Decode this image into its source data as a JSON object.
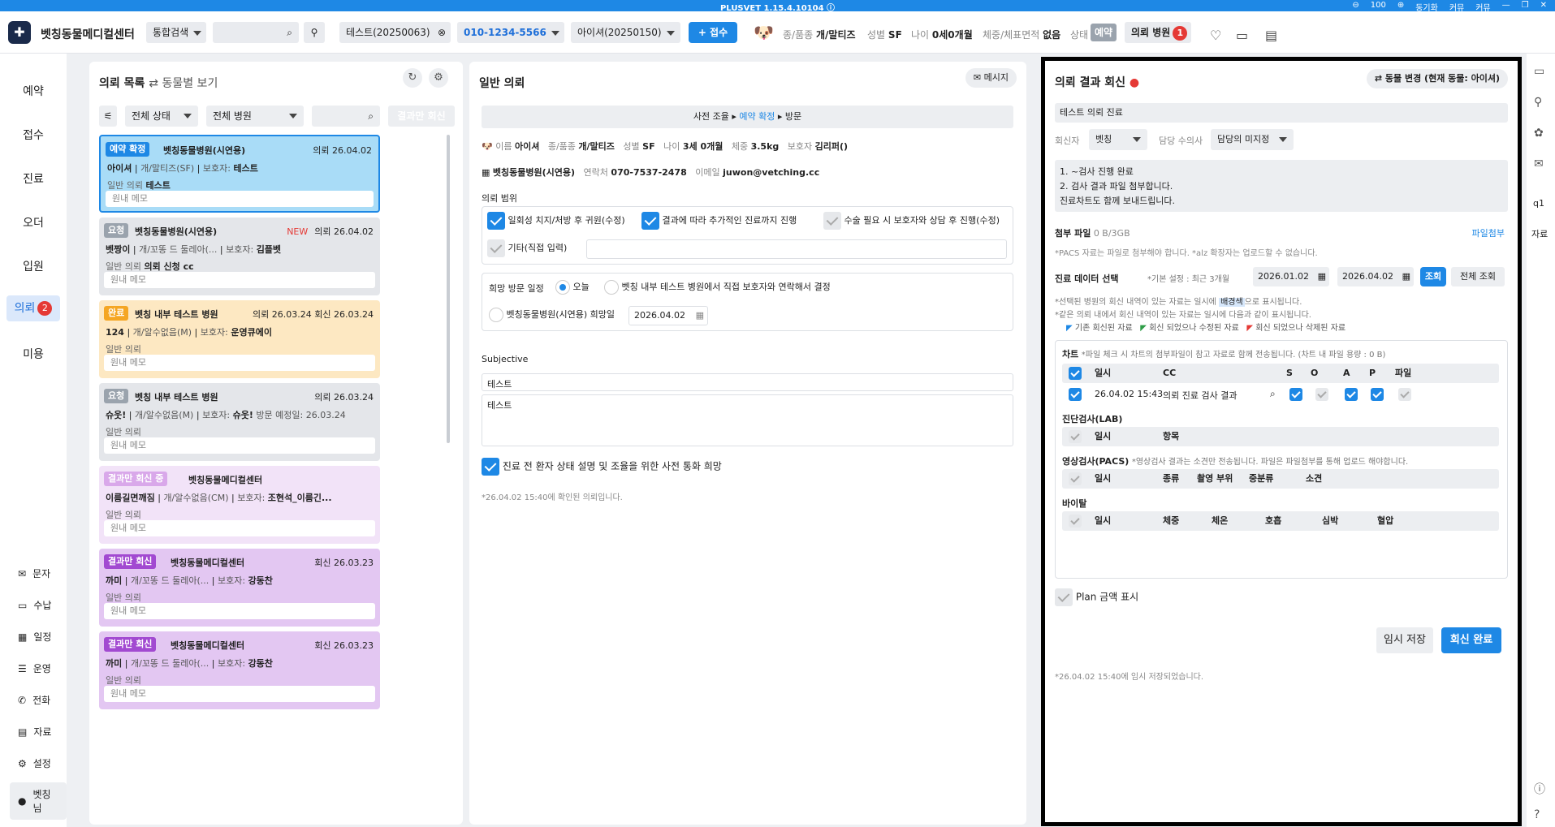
{
  "titlebar": {
    "app_version": "PLUSVET 1.15.4.10104",
    "zoom": "100",
    "links": [
      "동기화",
      "커뮤",
      "커뮤"
    ]
  },
  "topbar": {
    "brand": "벳칭동물메디컬센터",
    "search_type": "통합검색",
    "search_placeholder": "",
    "owner_chip": "테스트(20250063)",
    "phone": "010-1234-5566",
    "patient_chip": "아이셔(20250150)",
    "reception_button": "+ 접수",
    "species_label": "종/품종",
    "species_value": "개/말티즈",
    "sex_label": "성별",
    "sex_value": "SF",
    "age_label": "나이",
    "age_value": "0세0개월",
    "weight_label": "체중/체표면적",
    "weight_value": "없음",
    "status_label": "상태",
    "status_value": "예약",
    "referral_hospital": "의뢰 병원",
    "referral_count": "1"
  },
  "leftnav": {
    "items": [
      "예약",
      "접수",
      "진료",
      "오더",
      "입원",
      "의뢰",
      "미용"
    ],
    "active_index": 5,
    "referral_badge": "2",
    "bottom": [
      "문자",
      "수납",
      "일정",
      "운영",
      "전화",
      "자료",
      "설정",
      "벳칭님"
    ]
  },
  "list_panel": {
    "title": "의뢰 목록",
    "toggle": "동물별 보기",
    "status_filter": "전체 상태",
    "hospital_filter": "전체 병원",
    "result_only_button": "결과만 회신",
    "cards": [
      {
        "tag": "예약 확정",
        "hospital": "벳칭동물병원(시연용)",
        "date": "의뢰 26.04.02",
        "new": "",
        "patient": "아이셔",
        "breed": "개/말티즈(SF)",
        "owner_label": "보호자:",
        "owner": "테스트",
        "extra": "",
        "type": "일반 의뢰",
        "type_value": "테스트",
        "memo": "원내 메모"
      },
      {
        "tag": "요청",
        "hospital": "벳칭동물병원(시연용)",
        "date": "의뢰 26.04.02",
        "new": "NEW",
        "patient": "벳짱이",
        "breed": "개/꼬똥 드 둘레아(...",
        "owner_label": "보호자:",
        "owner": "김플벳",
        "extra": "",
        "type": "일반 의뢰",
        "type_value": "의뢰 신청 cc",
        "memo": "원내 메모"
      },
      {
        "tag": "완료",
        "hospital": "벳칭 내부 테스트 병원",
        "date": "의뢰 26.03.24  회신 26.03.24",
        "new": "",
        "patient": "124",
        "breed": "개/알수없음(M)",
        "owner_label": "보호자:",
        "owner": "운영큐에이",
        "extra": "",
        "type": "일반 의뢰",
        "type_value": "",
        "memo": "원내 메모"
      },
      {
        "tag": "요청",
        "hospital": "벳칭 내부 테스트 병원",
        "date": "의뢰 26.03.24",
        "new": "",
        "patient": "슈웃!",
        "breed": "개/알수없음(M)",
        "owner_label": "보호자:",
        "owner": "슈웃!",
        "extra": "방문 예정일: 26.03.24",
        "type": "일반 의뢰",
        "type_value": "",
        "memo": "원내 메모"
      },
      {
        "tag": "결과만 회신 중",
        "hospital": "벳칭동물메디컬센터",
        "date": "",
        "new": "",
        "patient": "이름길면깨짐",
        "breed": "개/알수없음(CM)",
        "owner_label": "보호자:",
        "owner": "조현석_이름긴...",
        "extra": "",
        "type": "일반 의뢰",
        "type_value": "",
        "memo": "원내 메모"
      },
      {
        "tag": "결과만 회신",
        "hospital": "벳칭동물메디컬센터",
        "date": "회신 26.03.23",
        "new": "",
        "patient": "까미",
        "breed": "개/꼬똥 드 둘레아(...",
        "owner_label": "보호자:",
        "owner": "강동찬",
        "extra": "",
        "type": "일반 의뢰",
        "type_value": "",
        "memo": "원내 메모"
      },
      {
        "tag": "결과만 회신",
        "hospital": "벳칭동물메디컬센터",
        "date": "회신 26.03.23",
        "new": "",
        "patient": "까미",
        "breed": "개/꼬똥 드 둘레아(...",
        "owner_label": "보호자:",
        "owner": "강동찬",
        "extra": "",
        "type": "일반 의뢰",
        "type_value": "",
        "memo": "원내 메모"
      }
    ]
  },
  "mid_panel": {
    "title": "일반 의뢰",
    "message_button": "메시지",
    "steps": [
      "사전 조율",
      "예약 확정",
      "방문"
    ],
    "name_label": "이름",
    "name": "아이셔",
    "species_label": "종/품종",
    "species": "개/말티즈",
    "sex_label": "성별",
    "sex": "SF",
    "age_label": "나이",
    "age": "3세 0개월",
    "weight_label": "체중",
    "weight": "3.5kg",
    "owner_label": "보호자",
    "owner": "김리퍼()",
    "hospital": "벳칭동물병원(시연용)",
    "contact_label": "연락처",
    "contact": "070-7537-2478",
    "email_label": "이메일",
    "email": "juwon@vetching.cc",
    "scope_title": "의뢰 범위",
    "scope1": "일회성 치지/처방 후 귀원(수정)",
    "scope2": "결과에 따라 추가적인 진료까지 진행",
    "scope3": "수술 필요 시 보호자와 상담 후 진행(수정)",
    "scope4": "기타(직접 입력)",
    "visit_title": "희망 방문 일정",
    "visit_opt1": "오늘",
    "visit_opt2": "벳칭 내부 테스트 병원에서 직접 보호자와 연락해서 결정",
    "visit_opt3": "벳칭동물병원(시연용) 희망일",
    "visit_date": "2026.04.02",
    "subjective_title": "Subjective",
    "subjective_1": "테스트",
    "subjective_2": "테스트",
    "phone_call_check": "진료 전 환자 상태 설명 및 조율을 위한 사전 통화 희망",
    "confirmed_note": "*26.04.02 15:40에 확인된 의뢰입니다."
  },
  "right_panel": {
    "title": "의뢰 결과 회신",
    "change_animal_button": "동물 변경 (현재 동물: 아이셔)",
    "subject": "테스트 의뢰 진료",
    "replier_label": "회신자",
    "replier": "벳칭",
    "vet_label": "담당 수의사",
    "vet": "담당의 미지정",
    "body_lines": [
      "1. ~검사 진행 완료",
      "2. 검사 결과 파일 첨부합니다.",
      "진료차트도 함께 보내드립니다."
    ],
    "attach_label": "첨부 파일",
    "attach_size": "0 B/3GB",
    "attach_button": "파일첨부",
    "attach_note": "*PACS 자료는 파일로 첨부해야 합니다.  *alz 확장자는 업로드할 수 없습니다.",
    "data_select_label": "진료 데이터 선택",
    "default_setting": "*기본 설정 : 최근 3개월",
    "date_from": "2026.01.02",
    "date_to": "2026.04.02",
    "search_button": "조회",
    "all_search_button": "전체 조회",
    "note1_a": "*선택된 병원의 회신 내역이 있는 자료는 일시에 ",
    "note1_hl": "배경색",
    "note1_b": "으로 표시됩니다.",
    "note2": "*같은 의뢰 내에서 회신 내역이 있는 자료는 일시에 다음과 같이 표시됩니다.",
    "legend": [
      "기존 회신된 자료",
      "회신 되었으나 수정된 자료",
      "회신 되었으나 삭제된 자료"
    ],
    "legend_colors": [
      "#1e88e5",
      "#2e9d47",
      "#e53935"
    ],
    "chart_label": "차트",
    "chart_note": "*파일 체크 시 차트의 첨부파일이 참고 자료로 함께 전송됩니다.  (차트 내 파일 용량 : 0 B)",
    "chart_headers": [
      "일시",
      "CC",
      "S",
      "O",
      "A",
      "P",
      "파일"
    ],
    "chart_row": {
      "datetime": "26.04.02 15:43",
      "cc": "의뢰 진료 검사 결과"
    },
    "lab_label": "진단검사(LAB)",
    "lab_headers": [
      "일시",
      "항목"
    ],
    "pacs_label": "영상검사(PACS)",
    "pacs_note": "*영상검사 결과는 소견만 전송됩니다. 파일은 파일첨부를 통해 업로드 해야합니다.",
    "pacs_headers": [
      "일시",
      "종류",
      "촬영 부위",
      "중분류",
      "소견"
    ],
    "vital_label": "바이탈",
    "vital_headers": [
      "일시",
      "체중",
      "체온",
      "호흡",
      "심박",
      "혈압"
    ],
    "plan_amount": "Plan 금액 표시",
    "temp_save": "임시 저장",
    "complete": "회신 완료",
    "saved_note": "*26.04.02 15:40에 임시 저장되었습니다."
  },
  "rightrail": {
    "items": [
      "q1",
      "자료"
    ]
  }
}
